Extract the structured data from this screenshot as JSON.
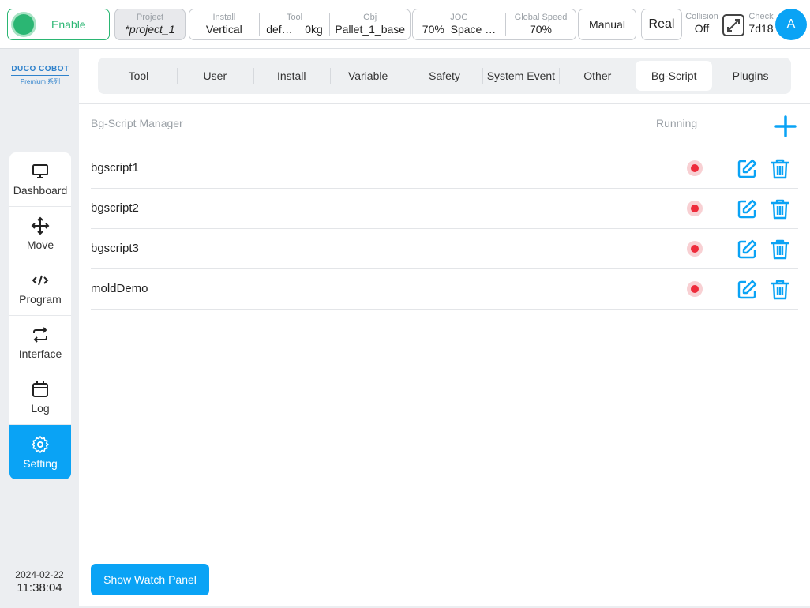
{
  "topbar": {
    "enable_label": "Enable",
    "project": {
      "label": "Project",
      "value": "*project_1"
    },
    "install": {
      "label": "Install",
      "value": "Vertical"
    },
    "tool": {
      "label": "Tool",
      "name": "def…",
      "load": "0kg"
    },
    "obj": {
      "label": "Obj",
      "value": "Pallet_1_base"
    },
    "jog": {
      "label": "JOG",
      "percent": "70%",
      "space": "Space …"
    },
    "global_speed": {
      "label": "Global Speed",
      "value": "70%"
    },
    "mode_label": "Manual",
    "real_label": "Real",
    "collision": {
      "label": "Collision",
      "value": "Off"
    },
    "check": {
      "label": "Check",
      "value": "7d18"
    },
    "avatar_letter": "A"
  },
  "sidebar": {
    "logo": {
      "main": "DUCO COBOT",
      "sub": "Premium 系列"
    },
    "items": [
      {
        "label": "Dashboard",
        "icon": "monitor-icon",
        "active": false
      },
      {
        "label": "Move",
        "icon": "move-arrows-icon",
        "active": false
      },
      {
        "label": "Program",
        "icon": "code-icon",
        "active": false
      },
      {
        "label": "Interface",
        "icon": "swap-icon",
        "active": false
      },
      {
        "label": "Log",
        "icon": "calendar-icon",
        "active": false
      },
      {
        "label": "Setting",
        "icon": "gear-icon",
        "active": true
      }
    ],
    "date": "2024-02-22",
    "time": "11:38:04"
  },
  "tabs": [
    "Tool",
    "User",
    "Install",
    "Variable",
    "Safety",
    "System Event",
    "Other",
    "Bg-Script",
    "Plugins"
  ],
  "active_tab": "Bg-Script",
  "bgscript": {
    "title": "Bg-Script Manager",
    "running_header": "Running",
    "scripts": [
      {
        "name": "bgscript1",
        "running": false
      },
      {
        "name": "bgscript2",
        "running": false
      },
      {
        "name": "bgscript3",
        "running": false
      },
      {
        "name": "moldDemo",
        "running": false
      }
    ]
  },
  "watch_panel_label": "Show Watch Panel",
  "colors": {
    "accent": "#0aa3f5",
    "enable_green": "#2bb673",
    "stopped_red": "#ee2b3b"
  }
}
